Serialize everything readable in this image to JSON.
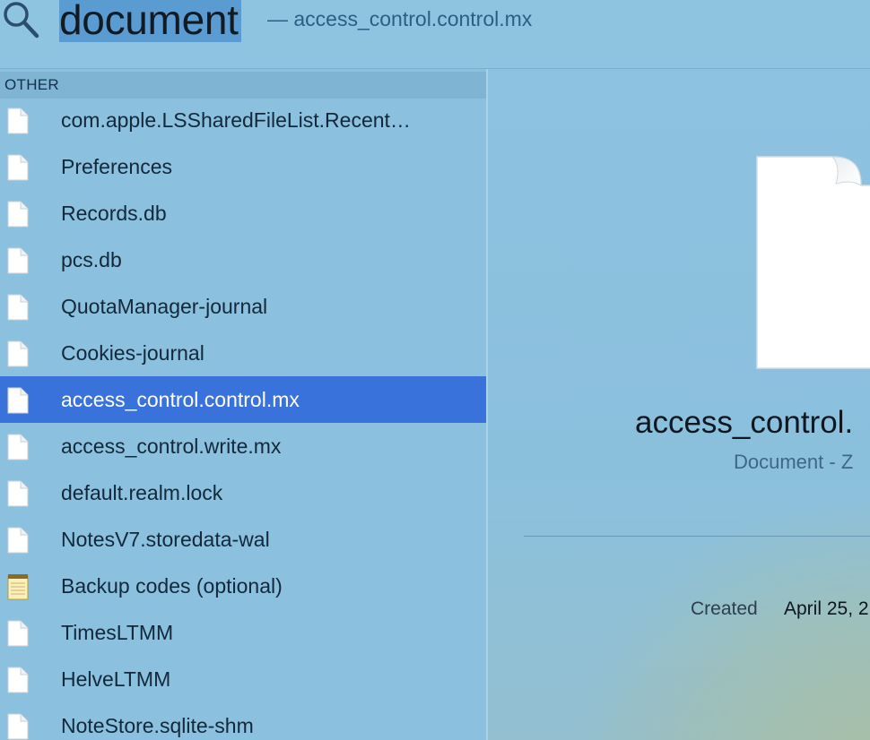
{
  "search": {
    "query": "document",
    "subtitle": "— access_control.control.mx"
  },
  "results": {
    "section_label": "OTHER",
    "items": [
      {
        "label": "com.apple.LSSharedFileList.Recent…",
        "icon": "document-icon"
      },
      {
        "label": "Preferences",
        "icon": "document-icon"
      },
      {
        "label": "Records.db",
        "icon": "document-icon"
      },
      {
        "label": "pcs.db",
        "icon": "document-icon"
      },
      {
        "label": "QuotaManager-journal",
        "icon": "document-icon"
      },
      {
        "label": "Cookies-journal",
        "icon": "document-icon"
      },
      {
        "label": "access_control.control.mx",
        "icon": "document-icon",
        "selected": true
      },
      {
        "label": "access_control.write.mx",
        "icon": "document-icon"
      },
      {
        "label": "default.realm.lock",
        "icon": "document-icon"
      },
      {
        "label": "NotesV7.storedata-wal",
        "icon": "document-icon"
      },
      {
        "label": "Backup codes (optional)",
        "icon": "notepad-icon"
      },
      {
        "label": "TimesLTMM",
        "icon": "document-icon"
      },
      {
        "label": "HelveLTMM",
        "icon": "document-icon"
      },
      {
        "label": "NoteStore.sqlite-shm",
        "icon": "document-icon"
      }
    ]
  },
  "preview": {
    "name": "access_control.",
    "kind": "Document - Z",
    "created_label": "Created",
    "created_value": "April 25, 2"
  },
  "colors": {
    "selection": "#3a72dc",
    "query_highlight": "#5a9bd1",
    "background": "#8bc0de"
  }
}
